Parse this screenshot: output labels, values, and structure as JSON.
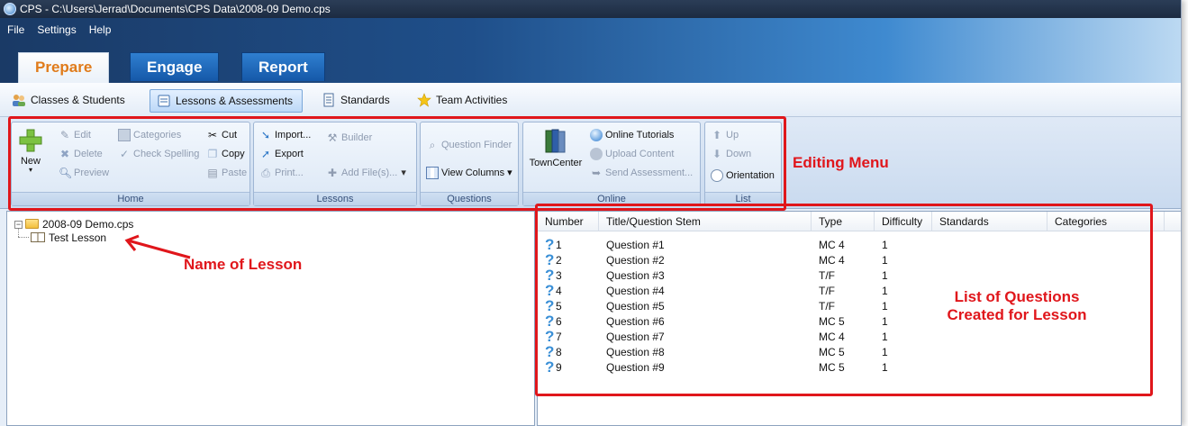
{
  "window": {
    "title": "CPS - C:\\Users\\Jerrad\\Documents\\CPS Data\\2008-09 Demo.cps"
  },
  "menu": [
    "File",
    "Settings",
    "Help"
  ],
  "main_tabs": [
    {
      "label": "Prepare",
      "active": true
    },
    {
      "label": "Engage",
      "active": false
    },
    {
      "label": "Report",
      "active": false
    }
  ],
  "sub_tabs": [
    {
      "label": "Classes & Students",
      "icon": "people-icon"
    },
    {
      "label": "Lessons & Assessments",
      "icon": "document-icon",
      "active": true
    },
    {
      "label": "Standards",
      "icon": "page-icon"
    },
    {
      "label": "Team Activities",
      "icon": "star-icon"
    }
  ],
  "ribbon": {
    "home": {
      "label": "Home",
      "new": "New",
      "edit": "Edit",
      "delete": "Delete",
      "preview": "Preview",
      "categories": "Categories",
      "check_spelling": "Check Spelling",
      "cut": "Cut",
      "copy": "Copy",
      "paste": "Paste"
    },
    "lessons": {
      "label": "Lessons",
      "import": "Import...",
      "export": "Export",
      "print": "Print...",
      "builder": "Builder",
      "add_files": "Add File(s)..."
    },
    "questions": {
      "label": "Questions",
      "finder": "Question Finder",
      "view_columns": "View Columns"
    },
    "online": {
      "label": "Online",
      "towncenter": "TownCenter",
      "tutorials": "Online Tutorials",
      "upload": "Upload Content",
      "send": "Send Assessment..."
    },
    "list": {
      "label": "List",
      "up": "Up",
      "down": "Down",
      "orientation": "Orientation"
    }
  },
  "annotations": {
    "editing_menu": "Editing Menu",
    "name_of_lesson": "Name of Lesson",
    "list_line1": "List of Questions",
    "list_line2": "Created for Lesson"
  },
  "tree": {
    "root": "2008-09 Demo.cps",
    "child": "Test Lesson"
  },
  "table": {
    "columns": [
      "Number",
      "Title/Question Stem",
      "Type",
      "Difficulty",
      "Standards",
      "Categories"
    ],
    "rows": [
      [
        "1",
        "Question #1",
        "MC 4",
        "1"
      ],
      [
        "2",
        "Question #2",
        "MC 4",
        "1"
      ],
      [
        "3",
        "Question #3",
        "T/F",
        "1"
      ],
      [
        "4",
        "Question #4",
        "T/F",
        "1"
      ],
      [
        "5",
        "Question #5",
        "T/F",
        "1"
      ],
      [
        "6",
        "Question #6",
        "MC 5",
        "1"
      ],
      [
        "7",
        "Question #7",
        "MC 4",
        "1"
      ],
      [
        "8",
        "Question #8",
        "MC 5",
        "1"
      ],
      [
        "9",
        "Question #9",
        "MC 5",
        "1"
      ]
    ]
  },
  "colors": {
    "annotation": "#e0161b",
    "active_tab_text": "#e07b1a"
  }
}
